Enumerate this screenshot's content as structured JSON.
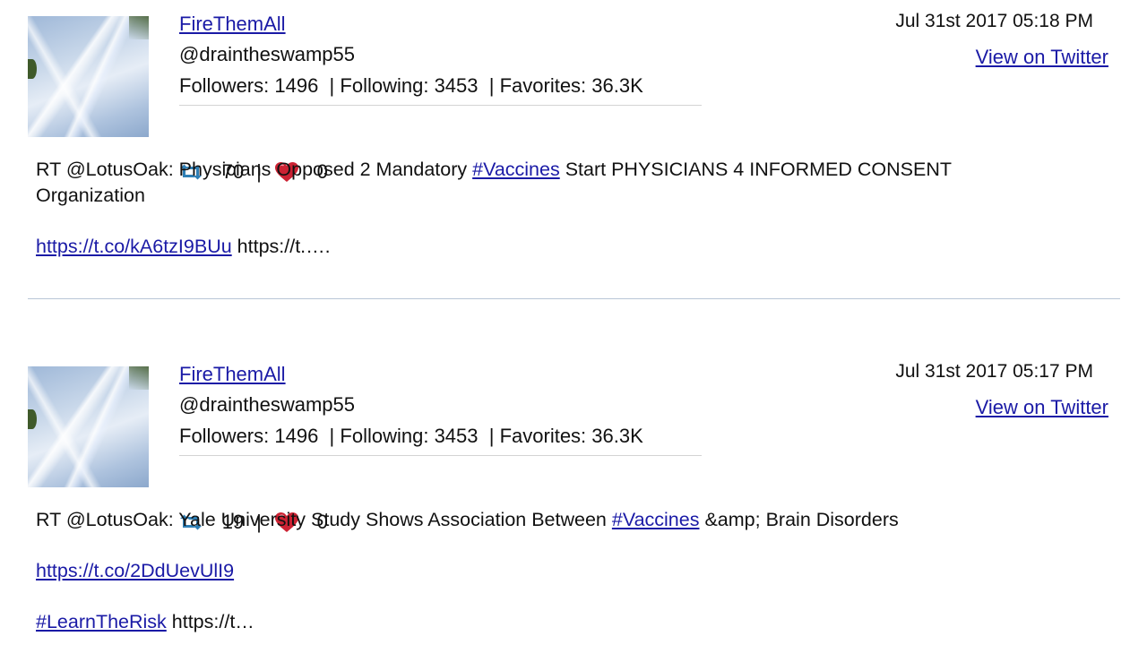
{
  "tweets": [
    {
      "name": "FireThemAll",
      "handle": "@draintheswamp55",
      "followers_label": "Followers:",
      "followers": "1496",
      "following_label": "Following:",
      "following": "3453",
      "favorites_label": "Favorites:",
      "favorites": "36.3K",
      "retweets": "70",
      "likes": "0",
      "date": "Jul 31st 2017 05:18 PM",
      "view_link": "View on Twitter",
      "text_prefix": "RT @LotusOak: Physicians Opposed 2 Mandatory",
      "hashtag": "#Vaccines",
      "text_suffix": "Start PHYSICIANS 4 INFORMED CONSENT",
      "text_line2": "Organization",
      "url": "https://t.co/kA6tzI9BUu",
      "url_trailing": "https://t.…."
    },
    {
      "name": "FireThemAll",
      "handle": "@draintheswamp55",
      "followers_label": "Followers:",
      "followers": "1496",
      "following_label": "Following:",
      "following": "3453",
      "favorites_label": "Favorites:",
      "favorites": "36.3K",
      "retweets": "19",
      "likes": "0",
      "date": "Jul 31st 2017 05:17 PM",
      "view_link": "View on Twitter",
      "text_prefix": "RT @LotusOak: Yale University Study Shows Association Between",
      "hashtag": "#Vaccines",
      "text_suffix": "&amp; Brain Disorders",
      "url": "https://t.co/2DdUevUlI9",
      "hashtag2": "#LearnTheRisk",
      "hashtag2_trailing": "https://t…"
    }
  ],
  "colors": {
    "link": "#1a1aa6",
    "retweet_icon": "#2f7fb5",
    "heart_icon": "#cc2233",
    "divider": "#b9c6d6"
  },
  "icons": {
    "retweet": "retweet-icon",
    "heart": "heart-icon"
  }
}
